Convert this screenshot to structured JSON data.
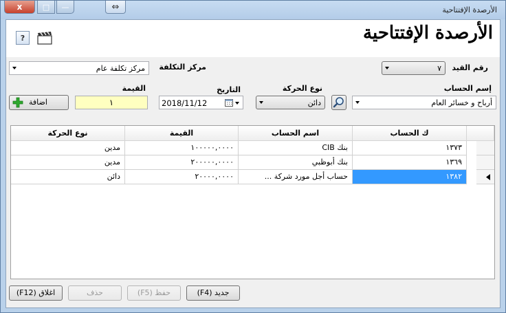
{
  "window": {
    "title": "الأرصدة الإفتتاحية",
    "close_glyph": "x",
    "max_glyph": "□",
    "min_glyph": "—",
    "swap_glyph": "⇔"
  },
  "header": {
    "title": "الأرصدة الإفتتاحية",
    "help_glyph": "?"
  },
  "form": {
    "entry_no_label": "رقم القيد",
    "entry_no_value": "٧",
    "cost_center_label": "مركز التكلفة",
    "cost_center_value": "مركز تكلفة عام",
    "account_label": "إسم الحساب",
    "account_value": "أرباح و خسائر العام",
    "movement_type_label": "نوع الحركة",
    "movement_type_value": "دائن",
    "date_label": "التاريخ",
    "date_value": "2018/11/12",
    "amount_label": "القيمة",
    "amount_value": "١",
    "add_button": "اضافة"
  },
  "table": {
    "headers": [
      "ك الحساب",
      "اسم الحساب",
      "القيمة",
      "نوع الحركة"
    ],
    "rows": [
      {
        "code": "١٣٧٣",
        "name": "بنك CIB",
        "amount": "١٠٠٠٠٠,٠٠٠٠",
        "type": "مدين"
      },
      {
        "code": "١٣٦٩",
        "name": "بنك أبوظبي",
        "amount": "٢٠٠٠٠٠,٠٠٠٠",
        "type": "مدين"
      },
      {
        "code": "١٣٨٢",
        "name": "حساب أجل مورد شركة ...",
        "amount": "٢٠٠٠٠,٠٠٠٠",
        "type": "دائن"
      }
    ],
    "selected_row": 2
  },
  "footer": {
    "new_button": "جديد (F4)",
    "save_button": "حفظ (F5)",
    "delete_button": "حذف",
    "close_button": "اغلاق (F12)"
  },
  "colors": {
    "selection": "#3399ff",
    "amount_field": "#ffffc0",
    "add_icon": "#2ea82e"
  }
}
